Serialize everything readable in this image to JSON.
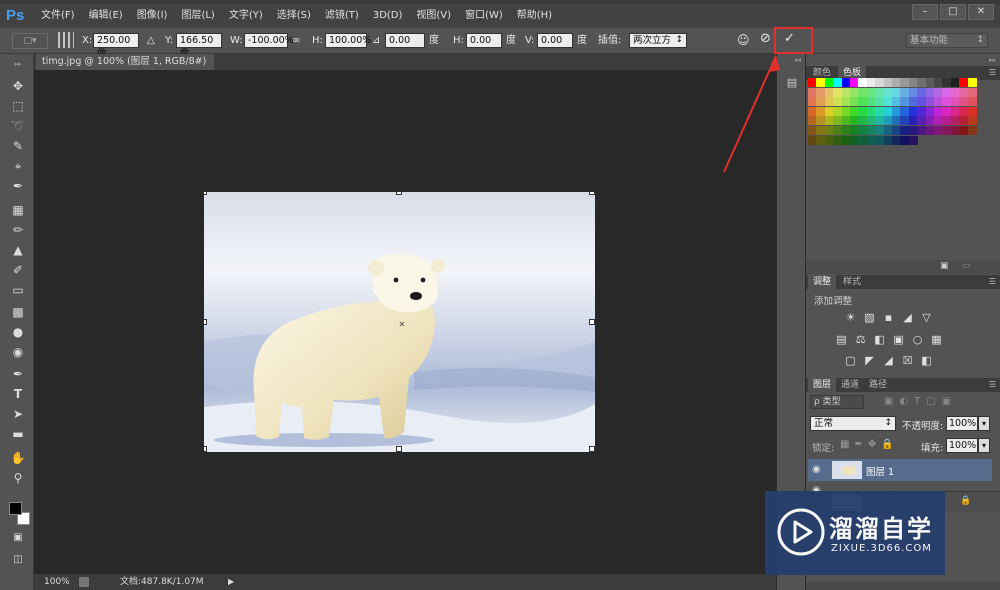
{
  "app": {
    "logo": "Ps"
  },
  "menu": [
    "文件(F)",
    "编辑(E)",
    "图像(I)",
    "图层(L)",
    "文字(Y)",
    "选择(S)",
    "滤镜(T)",
    "3D(D)",
    "视图(V)",
    "窗口(W)",
    "帮助(H)"
  ],
  "window_controls": {
    "minimize": "–",
    "maximize": "□",
    "close": "✕"
  },
  "options": {
    "x_label": "X:",
    "x_value": "250.00 像",
    "delta_glyph": "△",
    "y_label": "Y:",
    "y_value": "166.50 像",
    "w_label": "W:",
    "w_value": "-100.00%",
    "link_glyph": "∞",
    "h_label": "H:",
    "h_value": "100.00%",
    "angle_glyph": "⊿",
    "angle_value": "0.00",
    "angle_unit": "度",
    "hskew_label": "H:",
    "hskew_value": "0.00",
    "hskew_unit": "度",
    "vskew_label": "V:",
    "vskew_value": "0.00",
    "vskew_unit": "度",
    "interp_label": "插值:",
    "interp_value": "两次立方",
    "workspace": "基本功能",
    "commit_glyph": "✓",
    "cancel_glyph": "⊘"
  },
  "document": {
    "tab_title": "timg.jpg @ 100% (图层 1, RGB/8#) *",
    "tab_close": "×",
    "zoom": "100%",
    "doc_info": "文档:487.8K/1.07M"
  },
  "panels": {
    "color_tab": "颜色",
    "swatches_tab": "色板",
    "adjust_tab": "调整",
    "styles_tab": "样式",
    "add_adjustment": "添加调整",
    "layers_tab": "图层",
    "channels_tab": "通道",
    "paths_tab": "路径",
    "filter_kind": "ρ 类型",
    "blend_mode": "正常",
    "opacity_label": "不透明度:",
    "opacity_value": "100%",
    "lock_label": "锁定:",
    "fill_label": "填充:",
    "fill_value": "100%",
    "layer1_name": "图层 1"
  },
  "watermark": {
    "title": "溜溜自学",
    "url": "ZIXUE.3D66.COM"
  },
  "colors": {
    "accent_red": "#e0312e",
    "selected_layer": "#566c8c",
    "watermark_bg": "#273e6c"
  }
}
